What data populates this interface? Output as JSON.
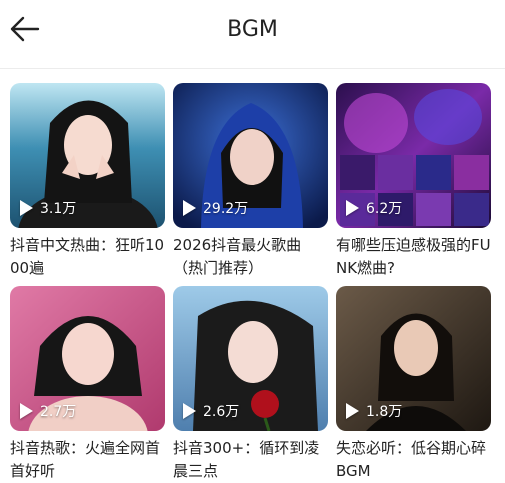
{
  "header": {
    "title": "BGM",
    "back_icon": "arrow-left-icon"
  },
  "playlists": [
    {
      "plays": "3.1万",
      "title": "抖音中文热曲：狂听1000遍"
    },
    {
      "plays": "29.2万",
      "title": "2026抖音最火歌曲（热门推荐）"
    },
    {
      "plays": "6.2万",
      "title": "有哪些压迫感极强的FUNK燃曲?"
    },
    {
      "plays": "2.7万",
      "title": "抖音热歌：火遍全网首首好听"
    },
    {
      "plays": "2.6万",
      "title": "抖音300+：循环到凌晨三点"
    },
    {
      "plays": "1.8万",
      "title": "失恋必听：低谷期心碎BGM"
    }
  ]
}
